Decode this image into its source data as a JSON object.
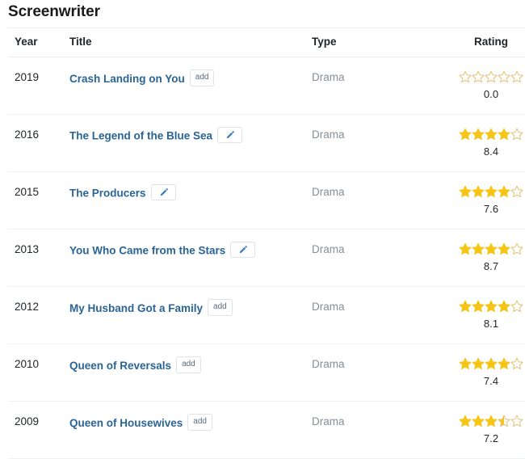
{
  "page": {
    "title": "Screenwriter"
  },
  "table": {
    "columns": [
      {
        "key": "year",
        "label": "Year"
      },
      {
        "key": "title",
        "label": "Title"
      },
      {
        "key": "type",
        "label": "Type"
      },
      {
        "key": "rating",
        "label": "Rating"
      }
    ],
    "rows": [
      {
        "year": "2019",
        "title": "Crash Landing on You",
        "action": {
          "kind": "add",
          "label": "add"
        },
        "type": "Drama",
        "rating_value": "0.0",
        "stars_filled": 0.0,
        "stars_total": 5
      },
      {
        "year": "2016",
        "title": "The Legend of the Blue Sea",
        "action": {
          "kind": "edit",
          "label": "",
          "icon": "pencil-icon"
        },
        "type": "Drama",
        "rating_value": "8.4",
        "stars_filled": 4.0,
        "stars_total": 5
      },
      {
        "year": "2015",
        "title": "The Producers",
        "action": {
          "kind": "edit",
          "label": "",
          "icon": "pencil-icon"
        },
        "type": "Drama",
        "rating_value": "7.6",
        "stars_filled": 4.0,
        "stars_total": 5
      },
      {
        "year": "2013",
        "title": "You Who Came from the Stars",
        "action": {
          "kind": "edit",
          "label": "",
          "icon": "pencil-icon"
        },
        "type": "Drama",
        "rating_value": "8.7",
        "stars_filled": 4.0,
        "stars_total": 5
      },
      {
        "year": "2012",
        "title": "My Husband Got a Family",
        "action": {
          "kind": "add",
          "label": "add"
        },
        "type": "Drama",
        "rating_value": "8.1",
        "stars_filled": 4.0,
        "stars_total": 5
      },
      {
        "year": "2010",
        "title": "Queen of Reversals",
        "action": {
          "kind": "add",
          "label": "add"
        },
        "type": "Drama",
        "rating_value": "7.4",
        "stars_filled": 4.0,
        "stars_total": 5
      },
      {
        "year": "2009",
        "title": "Queen of Housewives",
        "action": {
          "kind": "add",
          "label": "add"
        },
        "type": "Drama",
        "rating_value": "7.2",
        "stars_filled": 3.5,
        "stars_total": 5
      }
    ]
  },
  "colors": {
    "star_filled": "#f5c518",
    "star_empty_stroke": "#e0c173",
    "link": "#2a6496",
    "type_text": "#868e96",
    "divider": "#f0f1f3",
    "chip_border": "#dfe2e6",
    "chip_text": "#5a6b7d",
    "pencil": "#3d7ebd"
  }
}
